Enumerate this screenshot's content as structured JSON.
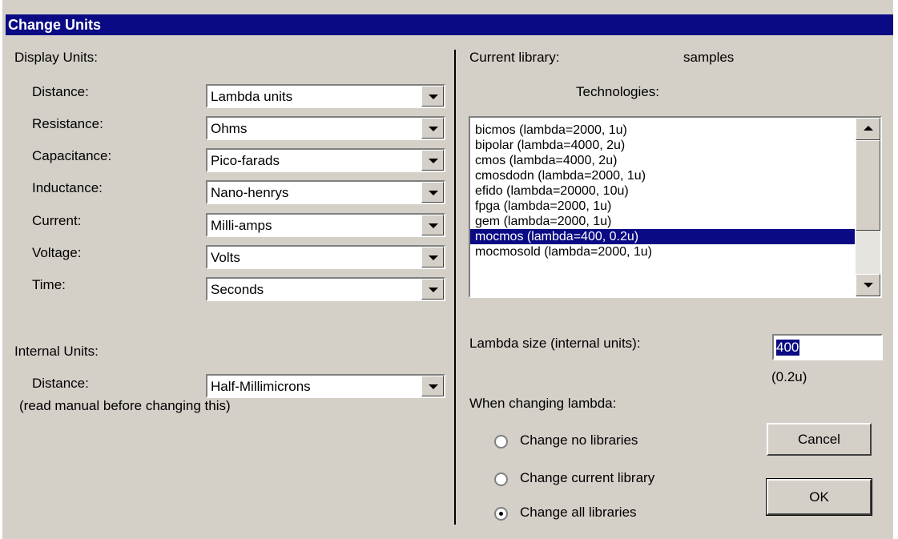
{
  "title": "Change Units",
  "display_units": {
    "heading": "Display Units:",
    "rows": [
      {
        "label": "Distance:",
        "value": "Lambda units"
      },
      {
        "label": "Resistance:",
        "value": "Ohms"
      },
      {
        "label": "Capacitance:",
        "value": "Pico-farads"
      },
      {
        "label": "Inductance:",
        "value": "Nano-henrys"
      },
      {
        "label": "Current:",
        "value": "Milli-amps"
      },
      {
        "label": "Voltage:",
        "value": "Volts"
      },
      {
        "label": "Time:",
        "value": "Seconds"
      }
    ]
  },
  "internal_units": {
    "heading": "Internal Units:",
    "distance_label": "Distance:",
    "distance_value": "Half-Millimicrons",
    "note": "(read manual before changing this)"
  },
  "library": {
    "label": "Current library:",
    "value": "samples"
  },
  "technologies": {
    "label": "Technologies:",
    "items": [
      "bicmos (lambda=2000, 1u)",
      "bipolar (lambda=4000, 2u)",
      "cmos (lambda=4000, 2u)",
      "cmosdodn (lambda=2000, 1u)",
      "efido (lambda=20000, 10u)",
      "fpga (lambda=2000, 1u)",
      "gem (lambda=2000, 1u)",
      "mocmos (lambda=400, 0.2u)",
      "mocmosold (lambda=2000, 1u)"
    ],
    "selected_index": 7
  },
  "lambda": {
    "label": "Lambda size (internal units):",
    "value": "400",
    "micron_display": "(0.2u)"
  },
  "changing": {
    "label": "When changing lambda:",
    "options": [
      "Change no libraries",
      "Change current library",
      "Change all libraries"
    ],
    "selected_index": 2
  },
  "buttons": {
    "cancel": "Cancel",
    "ok": "OK"
  }
}
